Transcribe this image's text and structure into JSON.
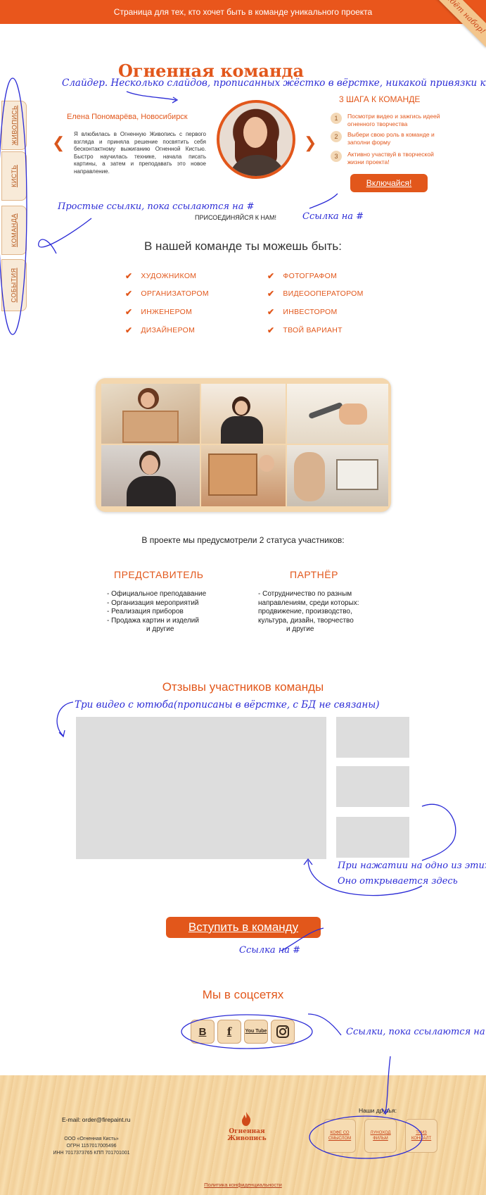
{
  "topbar": {
    "text": "Страница для тех, кто хочет быть в команде уникального проекта"
  },
  "ribbon": {
    "text": "Идёт набор!"
  },
  "side_tabs": [
    "ЖИВОПИСЬ",
    "КИСТЬ",
    "КОМАНДА",
    "СОБЫТИЯ"
  ],
  "brand": {
    "title": "Огненная команда"
  },
  "slider": {
    "prev_icon": "chevron-left-icon",
    "next_icon": "chevron-right-icon",
    "person": "Елена Пономарёва, Новосибирск",
    "quote": "Я влюбилась в Огненную Живопись с первого взгляда и приняла решение посвятить себя бесконтактному выжиганию Огненной Кистью. Быстро научилась технике, начала писать картины, а затем и преподавать это новое направление."
  },
  "steps": {
    "title": "3 ШАГА К КОМАНДЕ",
    "items": [
      {
        "num": "1",
        "text": "Посмотри видео и зажгись идеей огненного творчества"
      },
      {
        "num": "2",
        "text": "Выбери свою роль в команде и заполни форму"
      },
      {
        "num": "3",
        "text": "Активно участвуй в творческой жизни проекта!"
      }
    ],
    "button": "Включайся!",
    "join_text": "ПРИСОЕДИНЯЙСЯ К НАМ!"
  },
  "team": {
    "title": "В нашей команде ты можешь быть:",
    "roles_left": [
      "ХУДОЖНИКОМ",
      "ОРГАНИЗАТОРОМ",
      "ИНЖЕНЕРОМ",
      "ДИЗАЙНЕРОМ"
    ],
    "roles_right": [
      "ФОТОГРАФОМ",
      "ВИДЕООПЕРАТОРОМ",
      "ИНВЕСТОРОМ",
      "ТВОЙ ВАРИАНТ"
    ]
  },
  "statuses": {
    "title": "В проекте мы предусмотрели 2 статуса участников:",
    "representative": {
      "head": "ПРЕДСТАВИТЕЛЬ",
      "items": [
        "- Официальное преподавание",
        "- Организация мероприятий",
        "- Реализация приборов",
        "- Продажа картин и изделий",
        "и другие"
      ]
    },
    "partner": {
      "head": "ПАРТНЁР",
      "items": [
        "- Сотрудничество по разным",
        "направлениям, среди которых:",
        "продвижение, производство,",
        "культура, дизайн, творчество",
        "и другие"
      ]
    }
  },
  "reviews": {
    "title": "Отзывы участников команды"
  },
  "cta": {
    "label": "Вступить в команду"
  },
  "social": {
    "title": "Мы в соцсетях",
    "items": [
      {
        "label": "В",
        "icon": "vk-icon"
      },
      {
        "label": "f",
        "icon": "facebook-icon"
      },
      {
        "label": "You Tube",
        "icon": "youtube-icon"
      },
      {
        "label": "",
        "icon": "instagram-icon"
      }
    ]
  },
  "footer": {
    "email": "E-mail: order@firepaint.ru",
    "org_lines": [
      "ООО «Огненная Кисть»",
      "ОГРН 1157017005496",
      "ИНН 7017373765 КПП 701701001"
    ],
    "logo_text": "Огненная Живопись",
    "friends_title": "Наши друзья:",
    "friends": [
      "КОФЕ СО СМЫСЛОМ",
      "ЛУНОХОД ФИЛЬМ",
      "ТРИЗ КОНСАЛТ"
    ],
    "privacy": "Политика конфиденциальности"
  },
  "annotations": {
    "slider": "Слайдер. Несколько слайдов, прописанных жёстко в вёрстке, никакой привязки к БД",
    "simple_links": "Простые ссылки, пока ссылаются на #",
    "link_hash_1": "Ссылка на #",
    "videos": "Три видео с ютюба(прописаны в вёрстке, с БД не связаны)",
    "click_1": "При нажатии на одно из этих",
    "click_2": "Оно открывается здесь",
    "link_hash_2": "Ссылка на #",
    "social_links": "Ссылки, пока ссылаются на #"
  },
  "colors": {
    "accent": "#e2571b",
    "annotation": "#2b2bd6",
    "wood": "#f4d7ae"
  }
}
